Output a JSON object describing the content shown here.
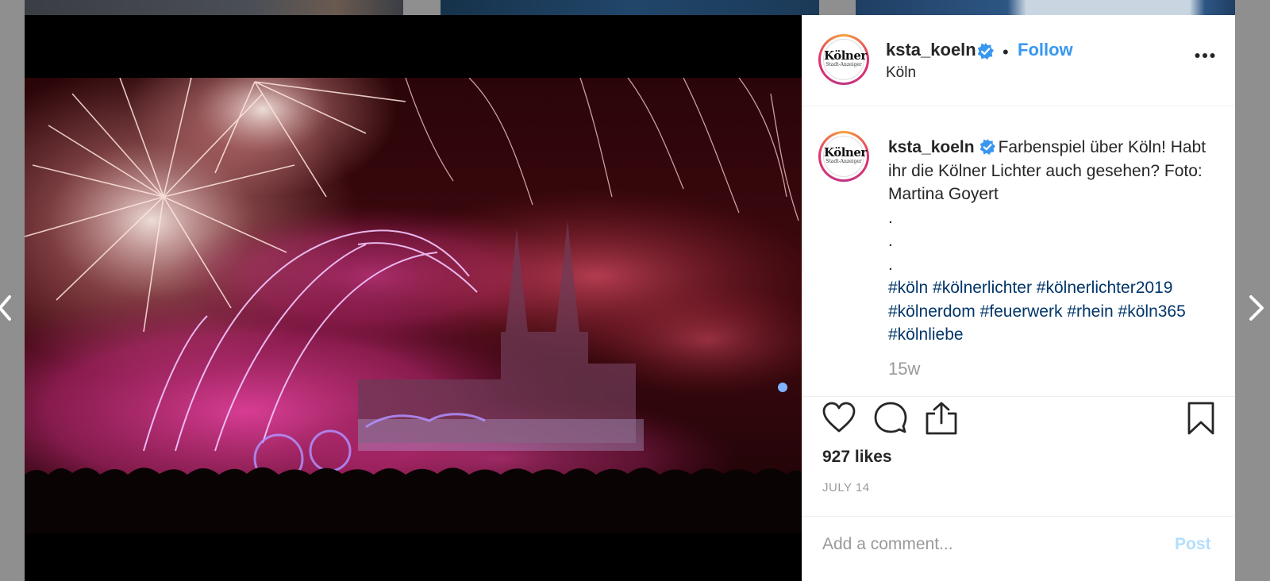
{
  "colors": {
    "accent": "#3897f0",
    "hashtag": "#003569",
    "muted": "#999999",
    "post_disabled": "#b2dffc"
  },
  "header": {
    "username": "ksta_koeln",
    "verified": true,
    "separator": "•",
    "follow_label": "Follow",
    "location": "Köln",
    "avatar_logo": {
      "main": "Kölner",
      "sub": "Stadt-Anzeiger"
    },
    "more_icon": "more-horizontal-icon"
  },
  "caption": {
    "username": "ksta_koeln",
    "verified": true,
    "text": "Farbenspiel über Köln! Habt ihr die Kölner Lichter auch gesehen? Foto: Martina Goyert",
    "dots": [
      ".",
      ".",
      "."
    ],
    "hashtags": [
      "#köln",
      "#kölnerlichter",
      "#kölnerlichter2019",
      "#kölnerdom",
      "#feuerwerk",
      "#rhein",
      "#köln365",
      "#kölnliebe"
    ],
    "time_ago": "15w"
  },
  "actions": {
    "like": "heart-icon",
    "comment": "comment-icon",
    "share": "share-icon",
    "save": "bookmark-icon"
  },
  "likes": "927 likes",
  "date": "JULY 14",
  "comment_box": {
    "placeholder": "Add a comment...",
    "post_label": "Post"
  },
  "navigation": {
    "prev": "chevron-left-icon",
    "next": "chevron-right-icon"
  }
}
